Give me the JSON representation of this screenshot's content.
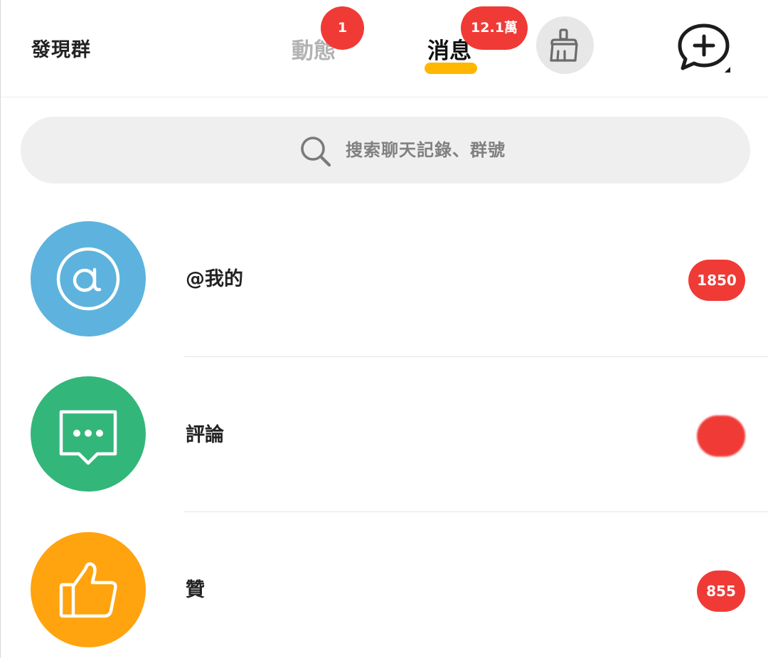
{
  "header": {
    "discover_label": "發現群",
    "tabs": [
      {
        "label": "動態",
        "badge": "1",
        "active": false
      },
      {
        "label": "消息",
        "badge": "12.1萬",
        "active": true
      }
    ],
    "clean_button_icon": "broom-icon",
    "add_chat_button_icon": "chat-plus-icon"
  },
  "search": {
    "placeholder": "搜索聊天記錄、群號",
    "icon": "search-icon"
  },
  "items": [
    {
      "label": "@我的",
      "count": "1850",
      "icon": "at-sign-icon",
      "color": "#5db3dd"
    },
    {
      "label": "評論",
      "count": "",
      "icon": "comment-bubble-icon",
      "color": "#33b67a"
    },
    {
      "label": "贊",
      "count": "855",
      "icon": "thumbs-up-icon",
      "color": "#ffa30f"
    }
  ],
  "colors": {
    "accent_underline": "#ffb700",
    "badge_red": "#f03a36",
    "active_tab_text": "#111111",
    "inactive_tab_text": "#b3b3b3"
  }
}
